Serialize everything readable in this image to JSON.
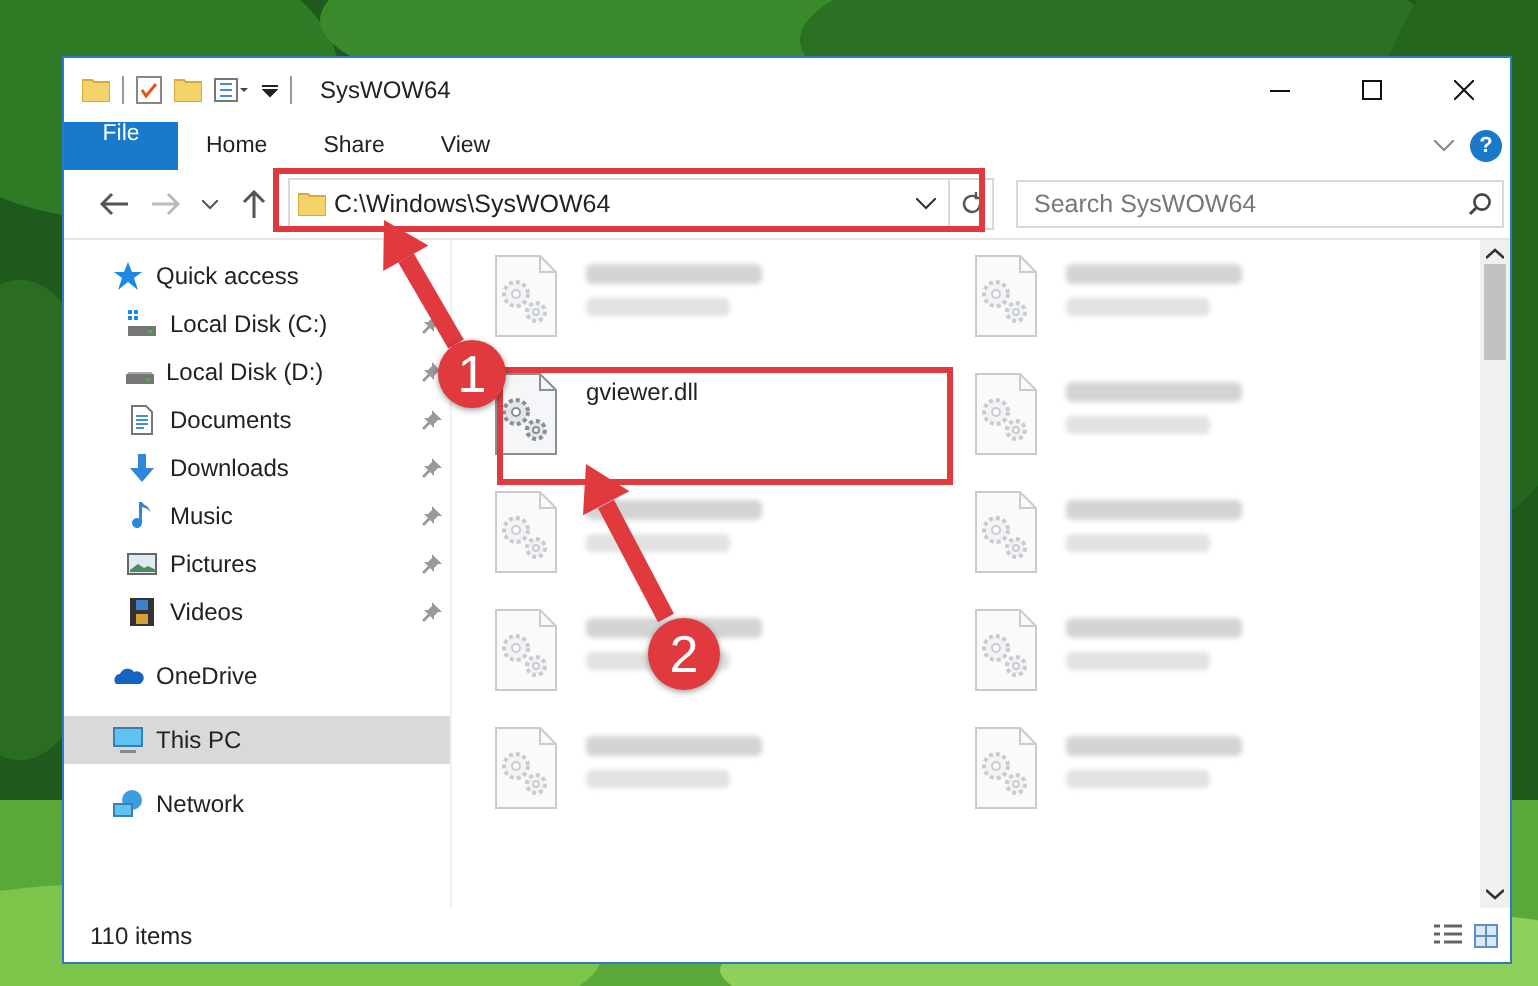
{
  "window": {
    "title": "SysWOW64"
  },
  "ribbon": {
    "tabs": [
      {
        "label": "File",
        "kind": "file"
      },
      {
        "label": "Home",
        "kind": "tab"
      },
      {
        "label": "Share",
        "kind": "tab"
      },
      {
        "label": "View",
        "kind": "tab"
      }
    ],
    "help": "?"
  },
  "address": {
    "path": "C:\\Windows\\SysWOW64"
  },
  "search": {
    "placeholder": "Search SysWOW64"
  },
  "sidebar": {
    "items": [
      {
        "label": "Quick access",
        "kind": "star",
        "selected": false,
        "children": [
          {
            "label": "Local Disk (C:)",
            "kind": "system-drive",
            "pinned": true,
            "selected": false
          },
          {
            "label": "Local Disk (D:)",
            "kind": "drive",
            "pinned": true,
            "selected": false
          },
          {
            "label": "Documents",
            "kind": "documents",
            "pinned": true,
            "selected": false
          },
          {
            "label": "Downloads",
            "kind": "downloads",
            "pinned": true,
            "selected": false
          },
          {
            "label": "Music",
            "kind": "music",
            "pinned": true,
            "selected": false
          },
          {
            "label": "Pictures",
            "kind": "pictures",
            "pinned": true,
            "selected": false
          },
          {
            "label": "Videos",
            "kind": "videos",
            "pinned": true,
            "selected": false
          }
        ]
      },
      {
        "label": "OneDrive",
        "kind": "cloud",
        "selected": false
      },
      {
        "label": "This PC",
        "kind": "computer",
        "selected": true
      },
      {
        "label": "Network",
        "kind": "network",
        "selected": false
      }
    ]
  },
  "files": [
    {
      "blurred": true
    },
    {
      "blurred": true
    },
    {
      "name": "gviewer.dll",
      "blurred": false
    },
    {
      "blurred": true
    },
    {
      "blurred": true
    },
    {
      "blurred": true
    },
    {
      "blurred": true
    },
    {
      "blurred": true
    },
    {
      "blurred": true
    },
    {
      "blurred": true
    }
  ],
  "status_bar": {
    "item_count": "110 items"
  },
  "annotations": [
    {
      "label": "1"
    },
    {
      "label": "2"
    }
  ]
}
